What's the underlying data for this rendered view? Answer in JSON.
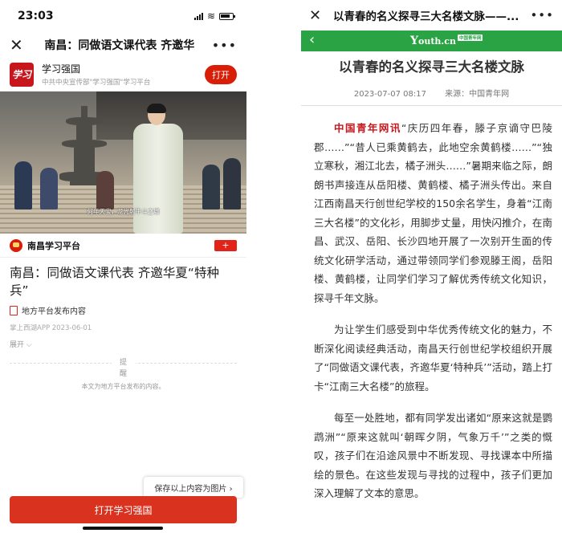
{
  "left": {
    "status": {
      "time": "23:03"
    },
    "navbar": {
      "title": "南昌：同做语文课代表 齐邀华"
    },
    "app_banner": {
      "logo_text": "学习",
      "name": "学习强国",
      "subtitle": "中共中央宣传部\"学习强国\"学习平台",
      "open_button": "打开"
    },
    "video": {
      "subtitle": "何年天宝，龙光射牛斗之墟"
    },
    "source": {
      "name": "南昌学习平台",
      "plus": "+"
    },
    "article": {
      "title": "南昌：同做语文课代表 齐邀华夏“特种兵”",
      "platform": "地方平台发布内容",
      "meta": "掌上西湖APP 2023-06-01",
      "expand": "展开 ⌵"
    },
    "reminder": {
      "title": "提醒",
      "desc": "本文为地方平台发布的内容。"
    },
    "save_image": "保存以上内容为图片 ›",
    "open_app_button": "打开学习强国"
  },
  "right": {
    "navbar": {
      "title": "以青春的名义探寻三大名楼文脉——..."
    },
    "logo": {
      "text": "outh.cn",
      "badge": "中国青年网"
    },
    "heading": "以青春的名义探寻三大名楼文脉",
    "meta": {
      "date": "2023-07-07 08:17",
      "source": "来源：中国青年网"
    },
    "paragraphs": {
      "p1_lead": "中国青年网讯",
      "p1": "“庆历四年春，滕子京谪守巴陵郡……”“昔人已乘黄鹤去，此地空余黄鹤楼……”“独立寒秋，湘江北去，橘子洲头……”暑期来临之际，朗朗书声接连从岳阳楼、黄鹤楼、橘子洲头传出。来自江西南昌天行创世纪学校的150余名学生，身着“江南三大名楼”的文化衫，用脚步丈量，用快闪推介，在南昌、武汉、岳阳、长沙四地开展了一次别开生面的传统文化研学活动，通过带领同学们参观滕王阁，岳阳楼、黄鹤楼，让同学们学习了解优秀传统文化知识，探寻千年文脉。",
      "p2": "为让学生们感受到中华优秀传统文化的魅力，不断深化阅读经典活动，南昌天行创世纪学校组织开展了“同做语文课代表，齐邀华夏‘特种兵’”活动，踏上打卡“江南三大名楼”的旅程。",
      "p3": "每至一处胜地，都有同学发出诸如“原来这就是鹦鹉洲”“原来这就叫‘朝晖夕阴，气象万千’”之类的慨叹，孩子们在沿途风景中不断发现、寻找课本中所描绘的景色。在这些发现与寻找的过程中，孩子们更加深入理解了文本的意思。"
    }
  }
}
